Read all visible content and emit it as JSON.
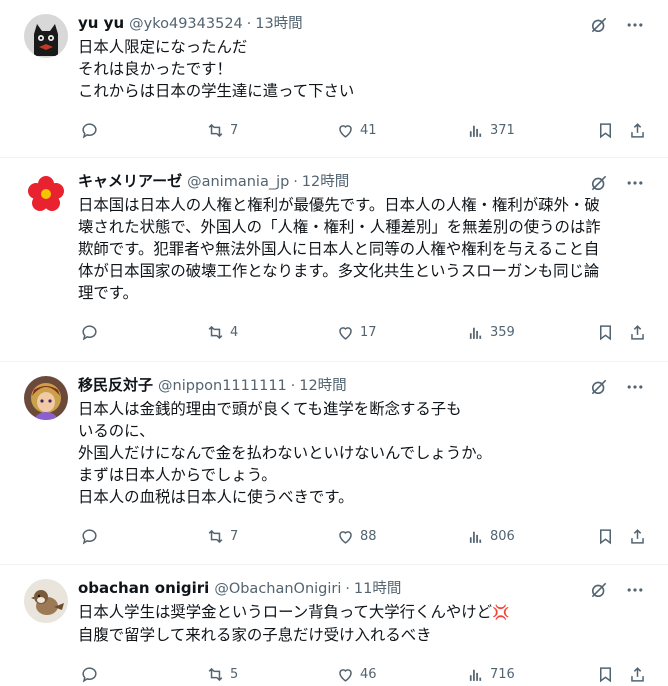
{
  "posts": [
    {
      "name": "yu yu",
      "handle": "@yko49343524",
      "time": "13時間",
      "lines": [
        "日本人限定になったんだ",
        "それは良かったです！",
        "これからは日本の学生達に遣って下さい"
      ],
      "retweets": "7",
      "likes": "41",
      "views": "371",
      "avatar": "black-cat-icon"
    },
    {
      "name": "キャメリアーゼ",
      "handle": "@animania_jp",
      "time": "12時間",
      "lines": [
        "日本国は日本人の人権と権利が最優先です。日本人の人権・権利が疎外・破",
        "壊された状態で、外国人の「人権・権利・人種差別」を無差別の使うのは詐",
        "欺師です。犯罪者や無法外国人に日本人と同等の人権や権利を与えること自",
        "体が日本国家の破壊工作となります。多文化共生というスローガンも同じ論",
        "理です。"
      ],
      "retweets": "4",
      "likes": "17",
      "views": "359",
      "avatar": "camellia-flower-icon"
    },
    {
      "name": "移民反対子",
      "handle": "@nippon1111111",
      "time": "12時間",
      "lines": [
        "日本人は金銭的理由で頭が良くても進学を断念する子も",
        "いるのに、",
        "外国人だけになんで金を払わないといけないんでしょうか。",
        "まずは日本人からでしょう。",
        "日本人の血税は日本人に使うべきです。"
      ],
      "retweets": "7",
      "likes": "88",
      "views": "806",
      "avatar": "anime-character-icon"
    },
    {
      "name": "obachan onigiri",
      "handle": "@ObachanOnigiri",
      "time": "11時間",
      "lines": [
        "日本人学生は奨学金というローン背負って大学行くんやけど",
        "自腹で留学して来れる家の子息だけ受け入れるべき"
      ],
      "emoji": "💢",
      "retweets": "5",
      "likes": "46",
      "views": "716",
      "avatar": "sparrow-bird-icon"
    }
  ],
  "separator": "·",
  "colors": {
    "text": "#0f1419",
    "muted": "#536471",
    "border": "#eff3f4",
    "accent": "#f91880"
  }
}
